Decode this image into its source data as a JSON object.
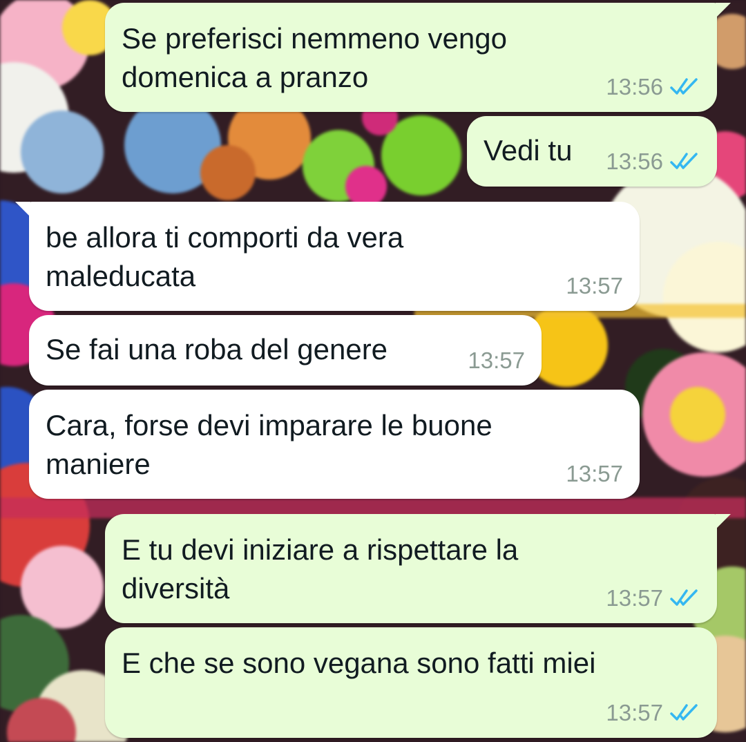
{
  "colors": {
    "outgoing_bubble": "#e8fdd7",
    "incoming_bubble": "#ffffff",
    "text": "#111b21",
    "timestamp": "#8a9a92",
    "read_ticks": "#34b7f1"
  },
  "wallpaper": {
    "description_icon": "flowers-wallpaper"
  },
  "messages": [
    {
      "direction": "outgoing",
      "text": "Se preferisci nemmeno vengo\ndomenica a pranzo",
      "time": "13:56",
      "status": "read",
      "status_icon": "double-check-icon"
    },
    {
      "direction": "outgoing",
      "text": "Vedi tu",
      "time": "13:56",
      "status": "read",
      "status_icon": "double-check-icon"
    },
    {
      "direction": "incoming",
      "text": "be allora ti comporti da vera\nmaleducata",
      "time": "13:57"
    },
    {
      "direction": "incoming",
      "text": "Se fai una roba del genere",
      "time": "13:57"
    },
    {
      "direction": "incoming",
      "text": "Cara, forse devi imparare le buone\nmaniere",
      "time": "13:57"
    },
    {
      "direction": "outgoing",
      "text": "E tu devi iniziare a rispettare la\ndiversità",
      "time": "13:57",
      "status": "read",
      "status_icon": "double-check-icon"
    },
    {
      "direction": "outgoing",
      "text": "E che se sono vegana sono fatti miei",
      "time": "13:57",
      "status": "read",
      "status_icon": "double-check-icon"
    }
  ]
}
